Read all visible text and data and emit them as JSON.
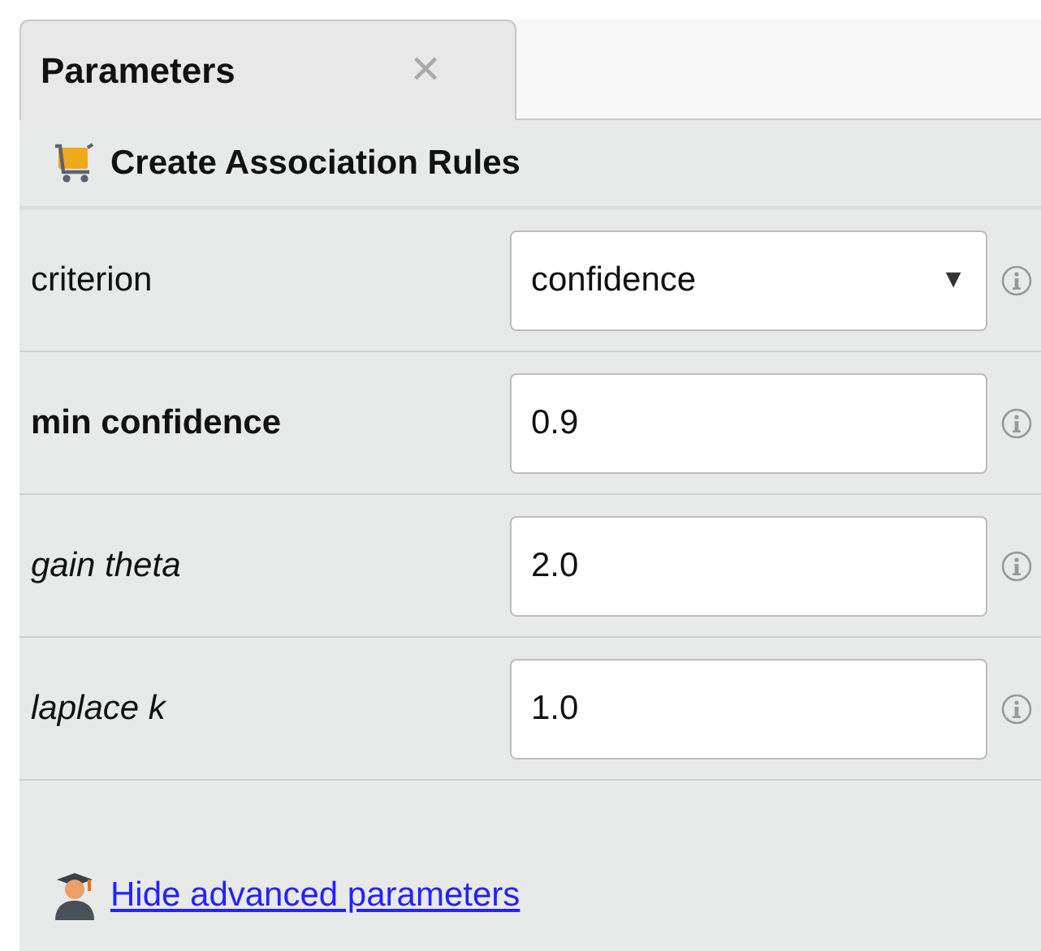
{
  "tab": {
    "label": "Parameters",
    "close": "✕",
    "selected": true
  },
  "operator": {
    "title": "Create Association Rules"
  },
  "parameters": [
    {
      "name": "criterion",
      "kind": "select",
      "value": "confidence",
      "caret": "▼"
    },
    {
      "name": "min confidence",
      "kind": "primary",
      "value": "0.9"
    },
    {
      "name": "gain theta",
      "kind": "expert",
      "value": "2.0"
    },
    {
      "name": "laplace k",
      "kind": "expert",
      "value": "1.0"
    }
  ],
  "advanced_link": "Hide advanced parameters"
}
